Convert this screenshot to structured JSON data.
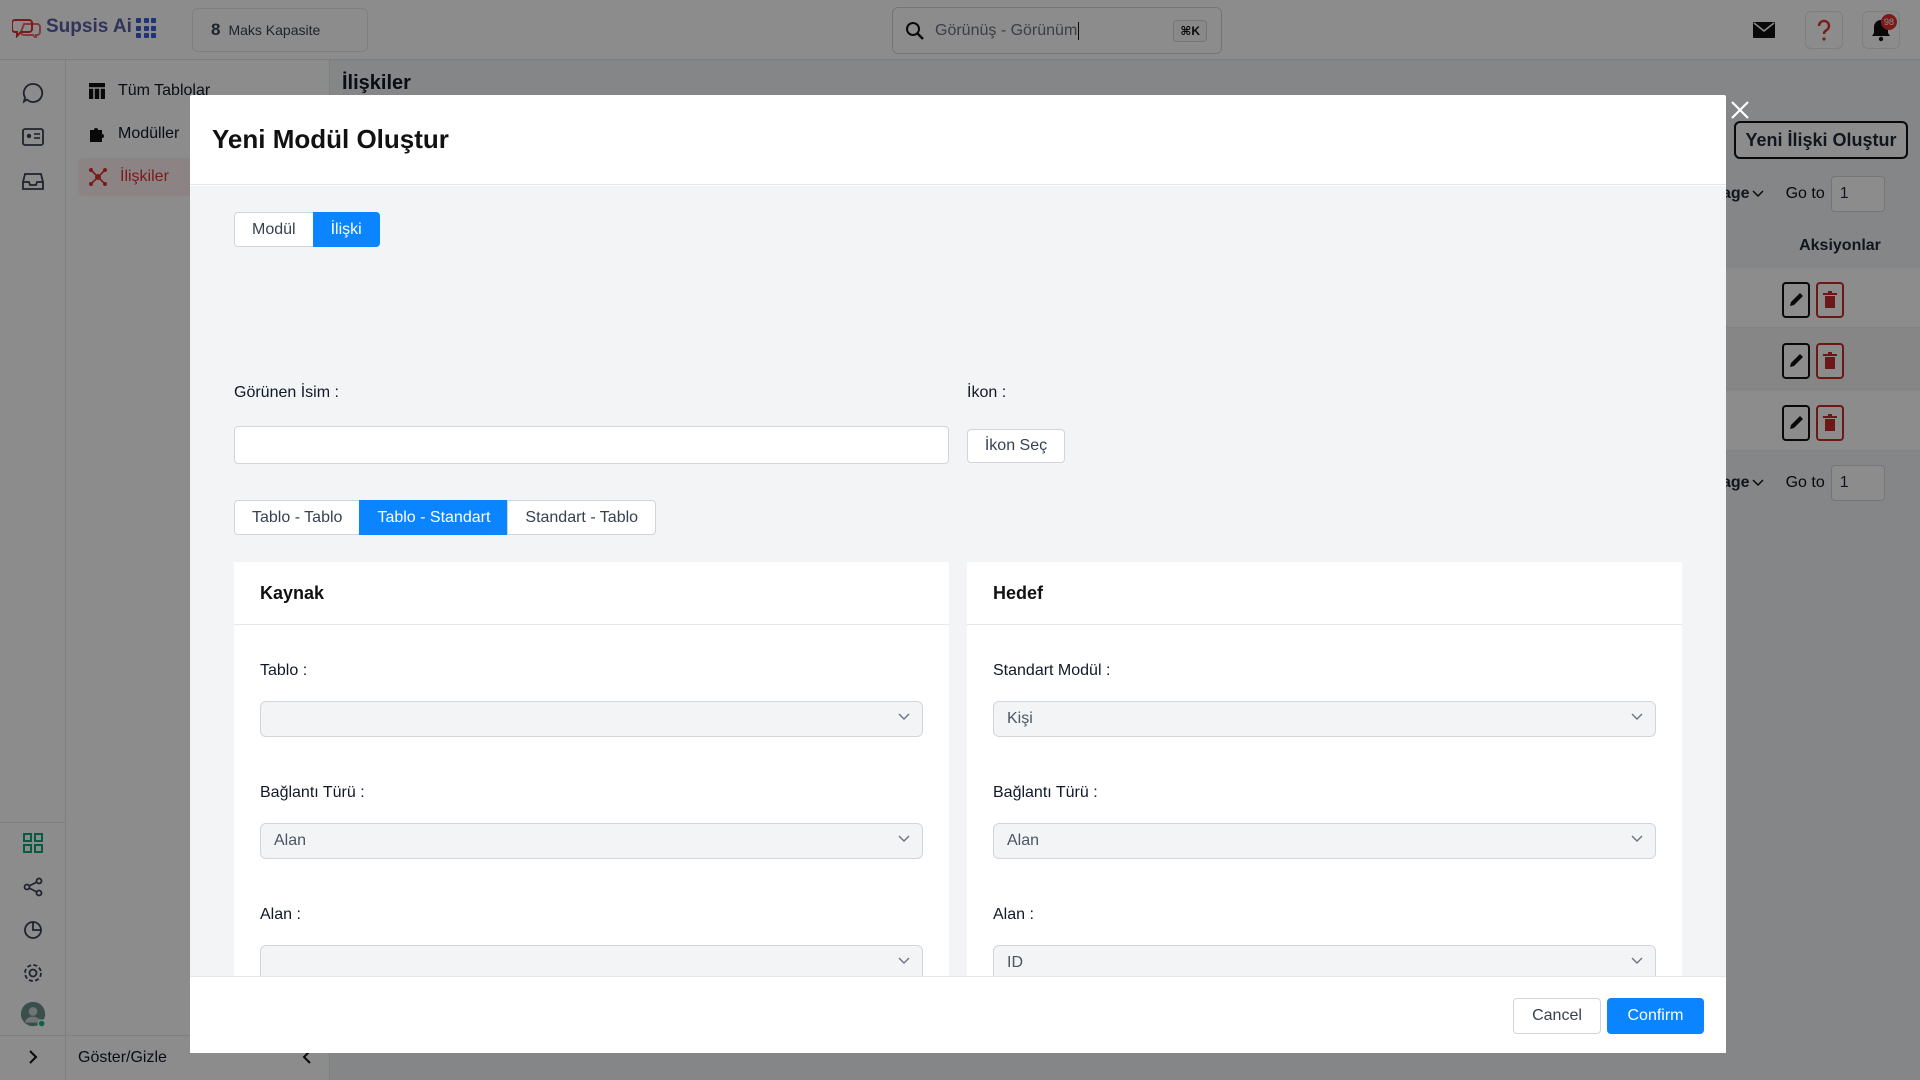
{
  "app": {
    "name": "Supsis Ai",
    "brand_color": "#5b5ea6"
  },
  "header": {
    "capacity_value": "8",
    "capacity_label": "Maks Kapasite",
    "search_text": "Görünüş - Görünüm",
    "search_shortcut": "⌘K",
    "notification_count": "98"
  },
  "sidebar": {
    "items": [
      {
        "label": "Tüm Tablolar",
        "icon": "table-icon"
      },
      {
        "label": "Modüller",
        "icon": "puzzle-icon"
      },
      {
        "label": "İlişkiler",
        "icon": "network-icon",
        "active": true
      }
    ],
    "toggle_label": "Göster/Gizle"
  },
  "page": {
    "title": "İlişkiler",
    "create_button": "Yeni İlişki Oluştur",
    "pager_page_label": "age",
    "pager_goto": "Go to",
    "pager_value": "1",
    "actions_header": "Aksiyonlar"
  },
  "modal": {
    "title": "Yeni Modül Oluştur",
    "mode_tabs": [
      {
        "label": "Modül",
        "selected": false
      },
      {
        "label": "İlişki",
        "selected": true
      }
    ],
    "display_name_label": "Görünen İsim",
    "display_name_value": "",
    "icon_label": "İkon",
    "icon_button": "İkon Seç",
    "relation_tabs": [
      {
        "label": "Tablo - Tablo",
        "selected": false
      },
      {
        "label": "Tablo - Standart",
        "selected": true
      },
      {
        "label": "Standart - Tablo",
        "selected": false
      }
    ],
    "source": {
      "title": "Kaynak",
      "table_label": "Tablo",
      "table_value": "",
      "connection_label": "Bağlantı Türü",
      "connection_value": "Alan",
      "field_label": "Alan",
      "field_value": ""
    },
    "target": {
      "title": "Hedef",
      "module_label": "Standart Modül",
      "module_value": "Kişi",
      "connection_label": "Bağlantı Türü",
      "connection_value": "Alan",
      "field_label": "Alan",
      "field_value": "ID"
    },
    "cancel_label": "Cancel",
    "confirm_label": "Confirm",
    "accent_color": "#0a84ff"
  }
}
